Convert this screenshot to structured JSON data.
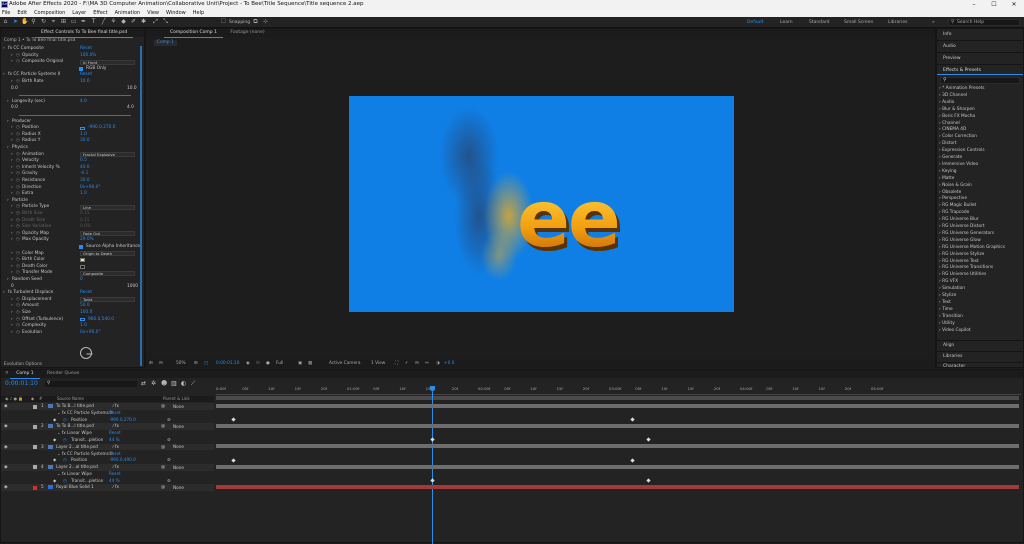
{
  "title_bar": {
    "app_icon": "Ae",
    "text": "Adobe After Effects 2020 - F:\\MA 3D Computer Animation\\Collaborative Unit\\Project - To Bee\\Title Sequence\\Title sequence 2.aep"
  },
  "menu": [
    "File",
    "Edit",
    "Composition",
    "Layer",
    "Effect",
    "Animation",
    "View",
    "Window",
    "Help"
  ],
  "toolbar": {
    "snapping_label": "Snapping",
    "workspaces": [
      "Default",
      "Learn",
      "Standard",
      "Small Screen",
      "Libraries"
    ],
    "active_workspace": "Default",
    "search_placeholder": "Search Help"
  },
  "effect_controls": {
    "tab_label": "Effect Controls To To Bee final title.psd",
    "header": "Comp 1 • To To Bee final title.psd",
    "rows": [
      {
        "indent": 0,
        "label": "fx  CC Composite",
        "value": "Reset",
        "vclass": "blue"
      },
      {
        "indent": 2,
        "label": "Opacity",
        "value": "100.0%",
        "vclass": "blue"
      },
      {
        "indent": 2,
        "label": "Composite Original",
        "value": "In Front",
        "dropdown": true
      },
      {
        "indent": 2,
        "label": "",
        "value": "RGB Only",
        "checkbox": true
      },
      {
        "indent": 0,
        "label": "fx  CC Particle Systems II",
        "value": "Reset",
        "vclass": "blue"
      },
      {
        "indent": 2,
        "label": "Birth Rate",
        "value": "10.0",
        "vclass": "blue"
      },
      {
        "indent": 3,
        "label": "0.0",
        "value": "10.0",
        "vclass": "",
        "right": true
      },
      {
        "indent": 2,
        "label": "",
        "value": "",
        "slider": true
      },
      {
        "indent": 1,
        "label": "Longevity (sec)",
        "value": "4.0",
        "vclass": "blue"
      },
      {
        "indent": 3,
        "label": "0.0",
        "value": "4.0",
        "vclass": "",
        "right": true
      },
      {
        "indent": 2,
        "label": "",
        "value": "",
        "slider": true
      },
      {
        "indent": 1,
        "label": "Producer",
        "value": ""
      },
      {
        "indent": 2,
        "label": "Position",
        "value": "-990.0,270.0",
        "vclass": "blue",
        "sw": true
      },
      {
        "indent": 2,
        "label": "Radius X",
        "value": "1.0",
        "vclass": "blue"
      },
      {
        "indent": 2,
        "label": "Radius Y",
        "value": "30.0",
        "vclass": "blue"
      },
      {
        "indent": 1,
        "label": "Physics",
        "value": ""
      },
      {
        "indent": 2,
        "label": "Animation",
        "value": "Fractal Explosive",
        "dropdown": true
      },
      {
        "indent": 2,
        "label": "Velocity",
        "value": "0.5",
        "vclass": "blue"
      },
      {
        "indent": 2,
        "label": "Inherit Velocity %",
        "value": "40.0",
        "vclass": "blue"
      },
      {
        "indent": 2,
        "label": "Gravity",
        "value": "-0.1",
        "vclass": "blue"
      },
      {
        "indent": 2,
        "label": "Resistance",
        "value": "30.0",
        "vclass": "blue"
      },
      {
        "indent": 2,
        "label": "Direction",
        "value": "0x+90.0°",
        "vclass": "blue"
      },
      {
        "indent": 2,
        "label": "Extra",
        "value": "1.0",
        "vclass": "blue"
      },
      {
        "indent": 1,
        "label": "Particle",
        "value": ""
      },
      {
        "indent": 2,
        "label": "Particle Type",
        "value": "Line",
        "dropdown": true
      },
      {
        "indent": 2,
        "label": "Birth Size",
        "value": "0.15",
        "vclass": "dim"
      },
      {
        "indent": 2,
        "label": "Death Size",
        "value": "0.15",
        "vclass": "dim"
      },
      {
        "indent": 2,
        "label": "Size Variation",
        "value": "0.0%",
        "vclass": "dim"
      },
      {
        "indent": 2,
        "label": "Opacity Map",
        "value": "Fade Out",
        "dropdown": true
      },
      {
        "indent": 2,
        "label": "Max Opacity",
        "value": "29.0%",
        "vclass": "blue"
      },
      {
        "indent": 2,
        "label": "",
        "value": "Source Alpha Inheritance",
        "checkbox": true
      },
      {
        "indent": 2,
        "label": "Color Map",
        "value": "Origin to Death",
        "dropdown": true
      },
      {
        "indent": 2,
        "label": "Birth Color",
        "value": "",
        "swatch": "#f3e48c"
      },
      {
        "indent": 2,
        "label": "Death Color",
        "value": "",
        "swatch": "#1c1c1c"
      },
      {
        "indent": 2,
        "label": "Transfer Mode",
        "value": "Composite",
        "dropdown": true
      },
      {
        "indent": 1,
        "label": "Random Seed",
        "value": "0",
        "vclass": "blue"
      },
      {
        "indent": 3,
        "label": "0",
        "value": "1000",
        "vclass": "",
        "right": true
      },
      {
        "indent": 0,
        "label": "fx  Turbulent Displace",
        "value": "Reset",
        "vclass": "blue"
      },
      {
        "indent": 2,
        "label": "Displacement",
        "value": "Twist",
        "dropdown": true
      },
      {
        "indent": 2,
        "label": "Amount",
        "value": "50.0",
        "vclass": "blue"
      },
      {
        "indent": 2,
        "label": "Size",
        "value": "100.0",
        "vclass": "blue"
      },
      {
        "indent": 2,
        "label": "Offset (Turbulence)",
        "value": "960.0,540.0",
        "vclass": "blue",
        "sw": true
      },
      {
        "indent": 2,
        "label": "Complexity",
        "value": "1.0",
        "vclass": "blue"
      },
      {
        "indent": 2,
        "label": "Evolution",
        "value": "0x+90.0°",
        "vclass": "blue"
      }
    ],
    "evolution_options": "Evolution Options"
  },
  "composition": {
    "tab_label": "Composition Comp 1",
    "footage_tab": "Footage (none)",
    "comp_chip": "Comp 1",
    "text_shown": "ee",
    "bg_color": "#0f7fe6",
    "bottom_bar": [
      "50%",
      "0:00:01:10",
      "Full",
      "Active Camera",
      "1 View",
      "+0.0"
    ]
  },
  "right_panels": {
    "top": [
      "Info",
      "Audio",
      "Preview"
    ],
    "effects_title": "Effects & Presets",
    "effects_items": [
      "* Animation Presets",
      "3D Channel",
      "Audio",
      "Blur & Sharpen",
      "Boris FX Mocha",
      "Channel",
      "CINEMA 4D",
      "Color Correction",
      "Distort",
      "Expression Controls",
      "Generate",
      "Immersive Video",
      "Keying",
      "Matte",
      "Noise & Grain",
      "Obsolete",
      "Perspective",
      "RG Magic Bullet",
      "RG Trapcode",
      "RG Universe Blur",
      "RG Universe Distort",
      "RG Universe Generators",
      "RG Universe Glow",
      "RG Universe Motion Graphics",
      "RG Universe Stylize",
      "RG Universe Text",
      "RG Universe Transitions",
      "RG Universe Utilities",
      "RG VFX",
      "Simulation",
      "Stylize",
      "Text",
      "Time",
      "Transition",
      "Utility",
      "Video Copilot"
    ],
    "bottom": [
      "Align",
      "Libraries",
      "Character"
    ]
  },
  "timeline": {
    "tabs": [
      "Comp 1",
      "Render Queue"
    ],
    "timecode": "0:00:01:10",
    "columns": [
      "Source Name",
      "Parent & Link"
    ],
    "ticks": [
      "0:00f",
      "05f",
      "10f",
      "15f",
      "20f",
      "01:00f",
      "05f",
      "10f",
      "15f",
      "20f",
      "02:00f",
      "05f",
      "10f",
      "15f",
      "20f",
      "03:00f",
      "05f",
      "10f",
      "15f",
      "20f",
      "04:00f",
      "05f",
      "10f",
      "15f",
      "20f",
      "05:00f"
    ],
    "layers": [
      {
        "num": "1",
        "name": "To To B...l title.psd",
        "type": "layer",
        "color": "#aaa",
        "parent": "None"
      },
      {
        "num": "",
        "name": "CC Particle Systems II",
        "type": "effect",
        "reset": "Reset"
      },
      {
        "num": "",
        "name": "Position",
        "type": "prop",
        "value": "-990.0,270.0"
      },
      {
        "num": "2",
        "name": "To To B...l title.psd",
        "type": "layer",
        "color": "#aaa",
        "parent": "None"
      },
      {
        "num": "",
        "name": "Linear Wipe",
        "type": "effect",
        "reset": "Reset"
      },
      {
        "num": "",
        "name": "Transit...pletion",
        "type": "prop",
        "value": "44 %"
      },
      {
        "num": "3",
        "name": "Layer 2...al title.psd",
        "type": "layer",
        "color": "#aaa",
        "parent": "None"
      },
      {
        "num": "",
        "name": "CC Particle Systems II",
        "type": "effect",
        "reset": "Reset"
      },
      {
        "num": "",
        "name": "Position",
        "type": "prop",
        "value": "-990.0,490.0"
      },
      {
        "num": "4",
        "name": "Layer 2...al title.psd",
        "type": "layer",
        "color": "#aaa",
        "parent": "None"
      },
      {
        "num": "",
        "name": "Linear Wipe",
        "type": "effect",
        "reset": "Reset"
      },
      {
        "num": "",
        "name": "Transit...pletion",
        "type": "prop",
        "value": "44 %"
      },
      {
        "num": "5",
        "name": "Royal Blue Solid 1",
        "type": "layer",
        "color": "#d03030",
        "parent": "None"
      }
    ]
  }
}
